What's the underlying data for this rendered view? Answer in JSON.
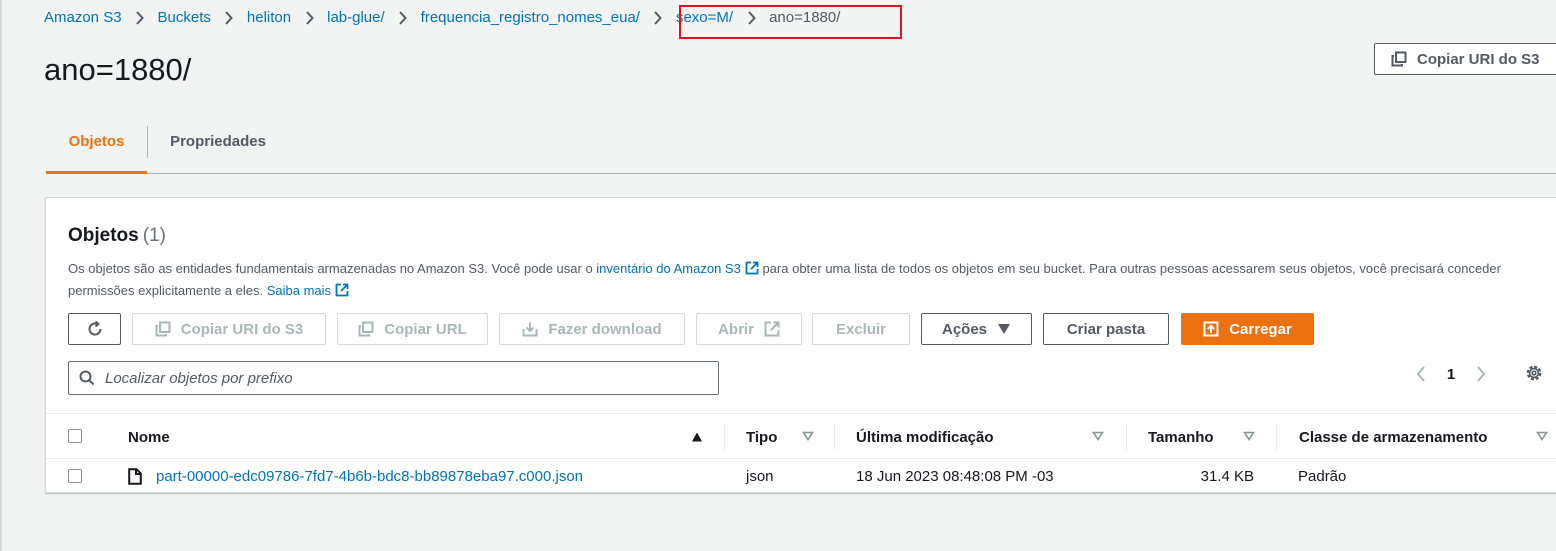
{
  "breadcrumb": {
    "items": [
      "Amazon S3",
      "Buckets",
      "heliton",
      "lab-glue/",
      "frequencia_registro_nomes_eua/",
      "sexo=M/"
    ],
    "current": "ano=1880/"
  },
  "header": {
    "title": "ano=1880/",
    "copy_uri_label": "Copiar URI do S3"
  },
  "tabs": [
    {
      "label": "Objetos",
      "active": true
    },
    {
      "label": "Propriedades",
      "active": false
    }
  ],
  "objects_panel": {
    "title": "Objetos",
    "count": "(1)",
    "description_part1": "Os objetos são as entidades fundamentais armazenadas no Amazon S3. Você pode usar o ",
    "description_link": "inventário do Amazon S3",
    "description_part2": " para obter uma lista de todos os objetos em seu bucket. Para outras pessoas acessarem seus objetos, você precisará conceder permissões explicitamente a eles. ",
    "learn_more": "Saiba mais"
  },
  "toolbar": {
    "copy_uri": "Copiar URI do S3",
    "copy_url": "Copiar URL",
    "download": "Fazer download",
    "open": "Abrir",
    "delete": "Excluir",
    "actions": "Ações",
    "create_folder": "Criar pasta",
    "upload": "Carregar"
  },
  "search": {
    "placeholder": "Localizar objetos por prefixo",
    "value": ""
  },
  "pagination": {
    "current_page": "1"
  },
  "table": {
    "columns": [
      "Nome",
      "Tipo",
      "Última modificação",
      "Tamanho",
      "Classe de armazenamento"
    ],
    "rows": [
      {
        "name": "part-00000-edc09786-7fd7-4b6b-bdc8-bb89878eba97.c000.json",
        "type": "json",
        "last_modified": "18 Jun 2023 08:48:08 PM -03",
        "size": "31.4 KB",
        "storage_class": "Padrão"
      }
    ]
  },
  "colors": {
    "link": "#0073bb",
    "accent": "#ec7211",
    "highlight_box": "#e0141e"
  }
}
